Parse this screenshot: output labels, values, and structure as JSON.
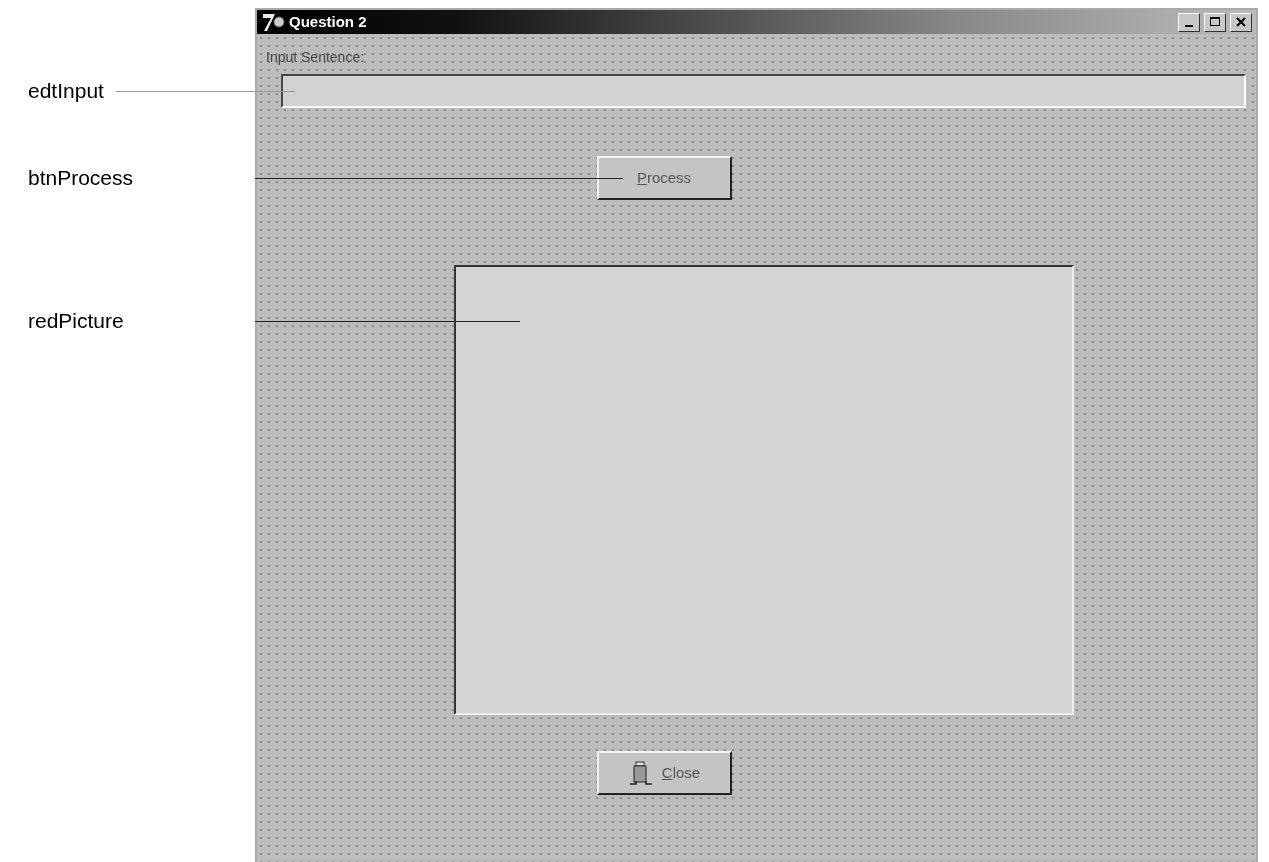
{
  "callouts": [
    {
      "label": "edtInput",
      "kind": "input"
    },
    {
      "label": "btnProcess",
      "kind": "process"
    },
    {
      "label": "redPicture",
      "kind": "memo"
    }
  ],
  "window": {
    "title": "Question 2",
    "controls": [
      {
        "kind": "minimize"
      },
      {
        "kind": "maximize"
      },
      {
        "kind": "close"
      }
    ]
  },
  "form": {
    "label": "Input Sentence:"
  },
  "process_button": {
    "label": "Process"
  },
  "close_button": {
    "label": "Close"
  }
}
